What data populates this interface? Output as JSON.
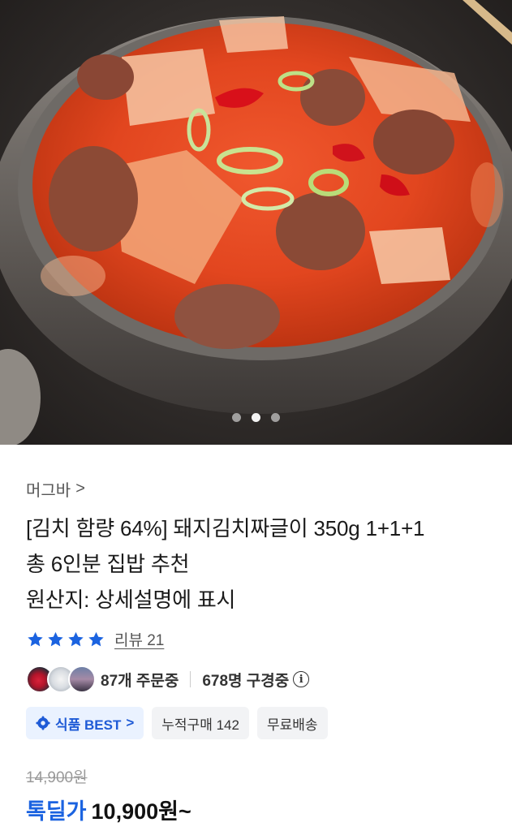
{
  "hero": {
    "image_alt": "",
    "carousel": {
      "count": 3,
      "active_index": 1
    }
  },
  "seller": {
    "name": "머그바",
    "chevron": ">"
  },
  "product": {
    "title_lines": [
      "[김치 함량 64%] 돼지김치짜글이 350g 1+1+1",
      "총 6인분 집밥 추천",
      "원산지: 상세설명에 표시"
    ]
  },
  "rating": {
    "stars": 4,
    "review_label": "리뷰 21",
    "star_color": "#1b63e0"
  },
  "social_proof": {
    "orders_text": "87개 주문중",
    "viewers_text": "678명 구경중",
    "info_icon": "i"
  },
  "badges": [
    {
      "label": "식품 BEST",
      "chevron": ">",
      "icon": "gear-icon"
    },
    {
      "label": "누적구매 142"
    },
    {
      "label": "무료배송"
    }
  ],
  "pricing": {
    "original_price": "14,900원",
    "deal_label": "톡딜가",
    "deal_price": "10,900원~"
  },
  "colors": {
    "accent": "#1b63e0",
    "best_badge_bg": "#eaf2ff"
  }
}
